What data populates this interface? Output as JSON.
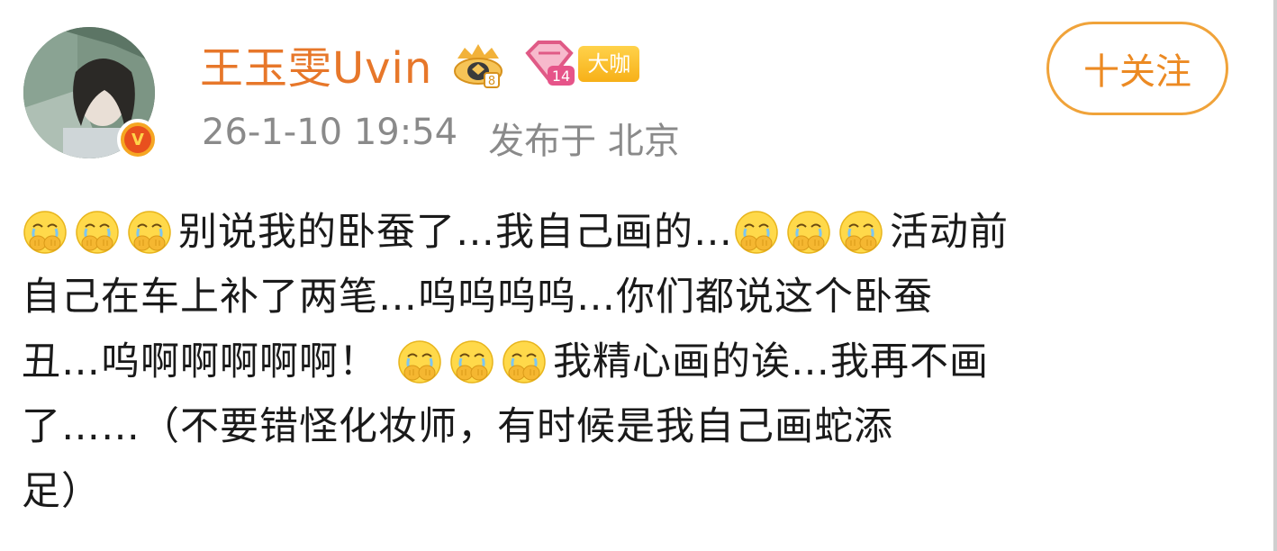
{
  "user": {
    "name": "王玉雯Uvin",
    "badge_label": "大咖",
    "vip_level": "14",
    "fan_level": "8"
  },
  "meta": {
    "timestamp": "26-1-10 19:54",
    "location": "发布于 北京"
  },
  "follow_button_label": "十关注",
  "post": {
    "line1_text_a": "别说我的卧蚕了…我自己画的…",
    "line1_text_b": "活动前",
    "line2": "自己在车上补了两笔…呜呜呜呜…你们都说这个卧蚕",
    "line3_text_a": "丑…呜啊啊啊啊啊！",
    "line3_text_b": "我精心画的诶…我再不画",
    "line4": "了……（不要错怪化妆师，有时候是我自己画蛇添",
    "line5": "足）"
  },
  "icons": {
    "emoji": "crying-covering-face-emoji",
    "verified": "verified-v-icon",
    "level": "crown-level-icon",
    "vip": "diamond-vip-icon"
  },
  "colors": {
    "username": "#e7772a",
    "follow_border": "#f0a33a",
    "meta_text": "#8a8a8a",
    "body_text": "#1a1a1a"
  }
}
